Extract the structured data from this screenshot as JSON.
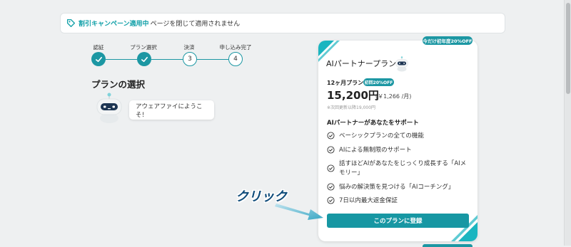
{
  "banner": {
    "highlight": "割引キャンペーン適用中",
    "text": "ページを閉じて適用されません"
  },
  "steps": [
    {
      "label": "認証",
      "state": "done",
      "number": ""
    },
    {
      "label": "プラン選択",
      "state": "done",
      "number": ""
    },
    {
      "label": "決済",
      "state": "todo",
      "number": "3"
    },
    {
      "label": "申し込み完了",
      "state": "todo",
      "number": "4"
    }
  ],
  "section_title": "プランの選択",
  "assistant_message": "アウェアファイにようこそ！",
  "card": {
    "promo_badge": "今だけ初年度20%OFF",
    "plan_name": "AIパートナープラン",
    "period": "12ヶ月プラン",
    "discount_badge": "初回20%OFF",
    "price": "15,200円",
    "monthly": "(￥1,266 /月)",
    "renewal_note": "※次回更新以降19,000円",
    "features_title": "AIパートナーがあなたをサポート",
    "features": [
      "ベーシックプランの全ての機能",
      "AIによる無制限のサポート",
      "話すほどAIがあなたをじっくり成長する「AIメモリー」",
      "悩みの解決策を見つける「AIコーチング」",
      "7日以内最大返金保証"
    ],
    "cta_label": "このプランに登録"
  },
  "annotation": {
    "click_label": "クリック"
  },
  "colors": {
    "accent": "#1c97a3",
    "background": "#eef0f1",
    "annotation_text": "#0e4b7a"
  }
}
